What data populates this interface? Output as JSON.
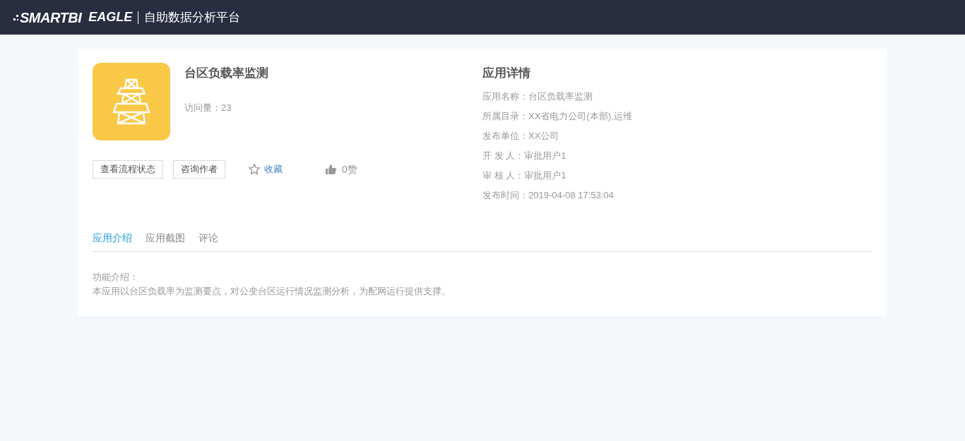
{
  "header": {
    "logo": "SMARTBI",
    "product": "EAGLE",
    "title": "自助数据分析平台"
  },
  "app": {
    "name": "台区负载率监测",
    "visits": "访问量：23",
    "actions": [
      {
        "kind": "button",
        "label": "查看流程状态"
      },
      {
        "kind": "button",
        "label": "咨询作者"
      },
      {
        "kind": "favorite",
        "label": "收藏"
      },
      {
        "kind": "like",
        "label": "0赞"
      }
    ]
  },
  "details": {
    "title": "应用详情",
    "rows": [
      {
        "label": "应用名称：",
        "value": "台区负载率监测"
      },
      {
        "label": "所属目录：",
        "value": "XX省电力公司(本部),运维"
      },
      {
        "label": "发布单位：",
        "value": "XX公司"
      },
      {
        "label": "开 发 人：",
        "value": "审批用户1"
      },
      {
        "label": "审 核 人：",
        "value": "审批用户1"
      },
      {
        "label": "发布时间：",
        "value": "2019-04-08 17:53:04"
      }
    ]
  },
  "tabs": [
    {
      "label": "应用介绍",
      "selected": true
    },
    {
      "label": "应用截图",
      "selected": false
    },
    {
      "label": "评论",
      "selected": false
    }
  ],
  "intro": {
    "heading": "功能介绍：",
    "text": "本应用以台区负载率为监测要点，对公变台区运行情况监测分析，为配网运行提供支撑。"
  }
}
